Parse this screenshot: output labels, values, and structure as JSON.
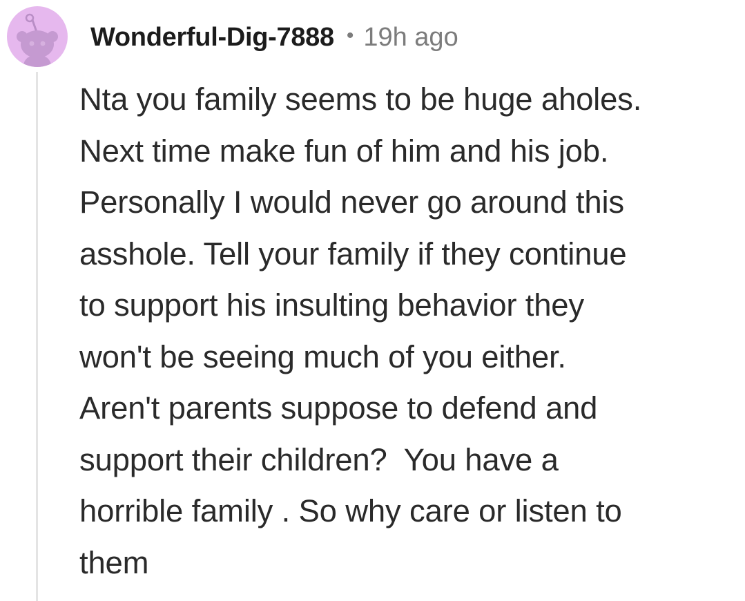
{
  "comment": {
    "username": "Wonderful-Dig-7888",
    "separator": "•",
    "timestamp": "19h ago",
    "body": "Nta you family seems to be huge aholes.\nNext time make fun of him and his job.\nPersonally I would never go around this\nasshole. Tell your family if they continue\nto support his insulting behavior they\nwon't be seeing much of you either.\nAren't parents suppose to defend and\nsupport their children?  You have a\nhorrible family . So why care or listen to\nthem",
    "avatar_icon": "snoo-avatar-icon",
    "colors": {
      "avatar_background": "#e6b8ee",
      "avatar_figure": "#b98ec6",
      "username": "#1c1c1c",
      "meta": "#7c7c7c",
      "thread_line": "#e4e4e4"
    }
  }
}
